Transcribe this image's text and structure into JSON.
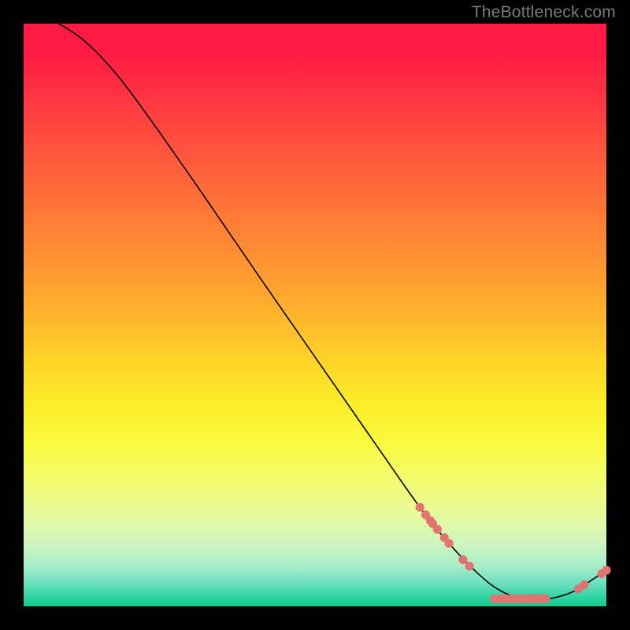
{
  "watermark": "TheBottleneck.com",
  "chart_data": {
    "type": "line",
    "title": "",
    "xlabel": "",
    "ylabel": "",
    "xlim": [
      0,
      100
    ],
    "ylim": [
      0,
      100
    ],
    "curve": [
      {
        "x": 6.0,
        "y": 100.0
      },
      {
        "x": 8.0,
        "y": 98.8
      },
      {
        "x": 10.0,
        "y": 97.4
      },
      {
        "x": 13.0,
        "y": 94.6
      },
      {
        "x": 17.0,
        "y": 90.0
      },
      {
        "x": 22.0,
        "y": 83.2
      },
      {
        "x": 30.0,
        "y": 71.8
      },
      {
        "x": 40.0,
        "y": 57.2
      },
      {
        "x": 50.0,
        "y": 42.8
      },
      {
        "x": 60.0,
        "y": 28.4
      },
      {
        "x": 68.0,
        "y": 17.0
      },
      {
        "x": 73.0,
        "y": 10.8
      },
      {
        "x": 78.0,
        "y": 5.6
      },
      {
        "x": 82.0,
        "y": 2.6
      },
      {
        "x": 86.0,
        "y": 1.3
      },
      {
        "x": 90.0,
        "y": 1.3
      },
      {
        "x": 94.0,
        "y": 2.4
      },
      {
        "x": 97.0,
        "y": 4.2
      },
      {
        "x": 100.0,
        "y": 6.2
      }
    ],
    "points": [
      {
        "x": 68.0,
        "y": 17.0
      },
      {
        "x": 69.0,
        "y": 15.7
      },
      {
        "x": 69.8,
        "y": 14.7
      },
      {
        "x": 70.2,
        "y": 14.2
      },
      {
        "x": 71.0,
        "y": 13.2
      },
      {
        "x": 72.2,
        "y": 11.8
      },
      {
        "x": 73.0,
        "y": 10.8
      },
      {
        "x": 75.4,
        "y": 8.0
      },
      {
        "x": 76.5,
        "y": 6.9
      },
      {
        "x": 80.8,
        "y": 1.3
      },
      {
        "x": 81.5,
        "y": 1.3
      },
      {
        "x": 82.3,
        "y": 1.3
      },
      {
        "x": 83.0,
        "y": 1.3
      },
      {
        "x": 83.7,
        "y": 1.3
      },
      {
        "x": 84.3,
        "y": 1.3
      },
      {
        "x": 85.0,
        "y": 1.3
      },
      {
        "x": 85.6,
        "y": 1.3
      },
      {
        "x": 86.3,
        "y": 1.3
      },
      {
        "x": 87.0,
        "y": 1.3
      },
      {
        "x": 87.6,
        "y": 1.3
      },
      {
        "x": 88.3,
        "y": 1.3
      },
      {
        "x": 89.0,
        "y": 1.3
      },
      {
        "x": 89.6,
        "y": 1.3
      },
      {
        "x": 95.2,
        "y": 3.0
      },
      {
        "x": 96.2,
        "y": 3.7
      },
      {
        "x": 99.2,
        "y": 5.6
      },
      {
        "x": 100.0,
        "y": 6.2
      }
    ],
    "point_color": "#e2736f",
    "line_color": "#000000"
  }
}
